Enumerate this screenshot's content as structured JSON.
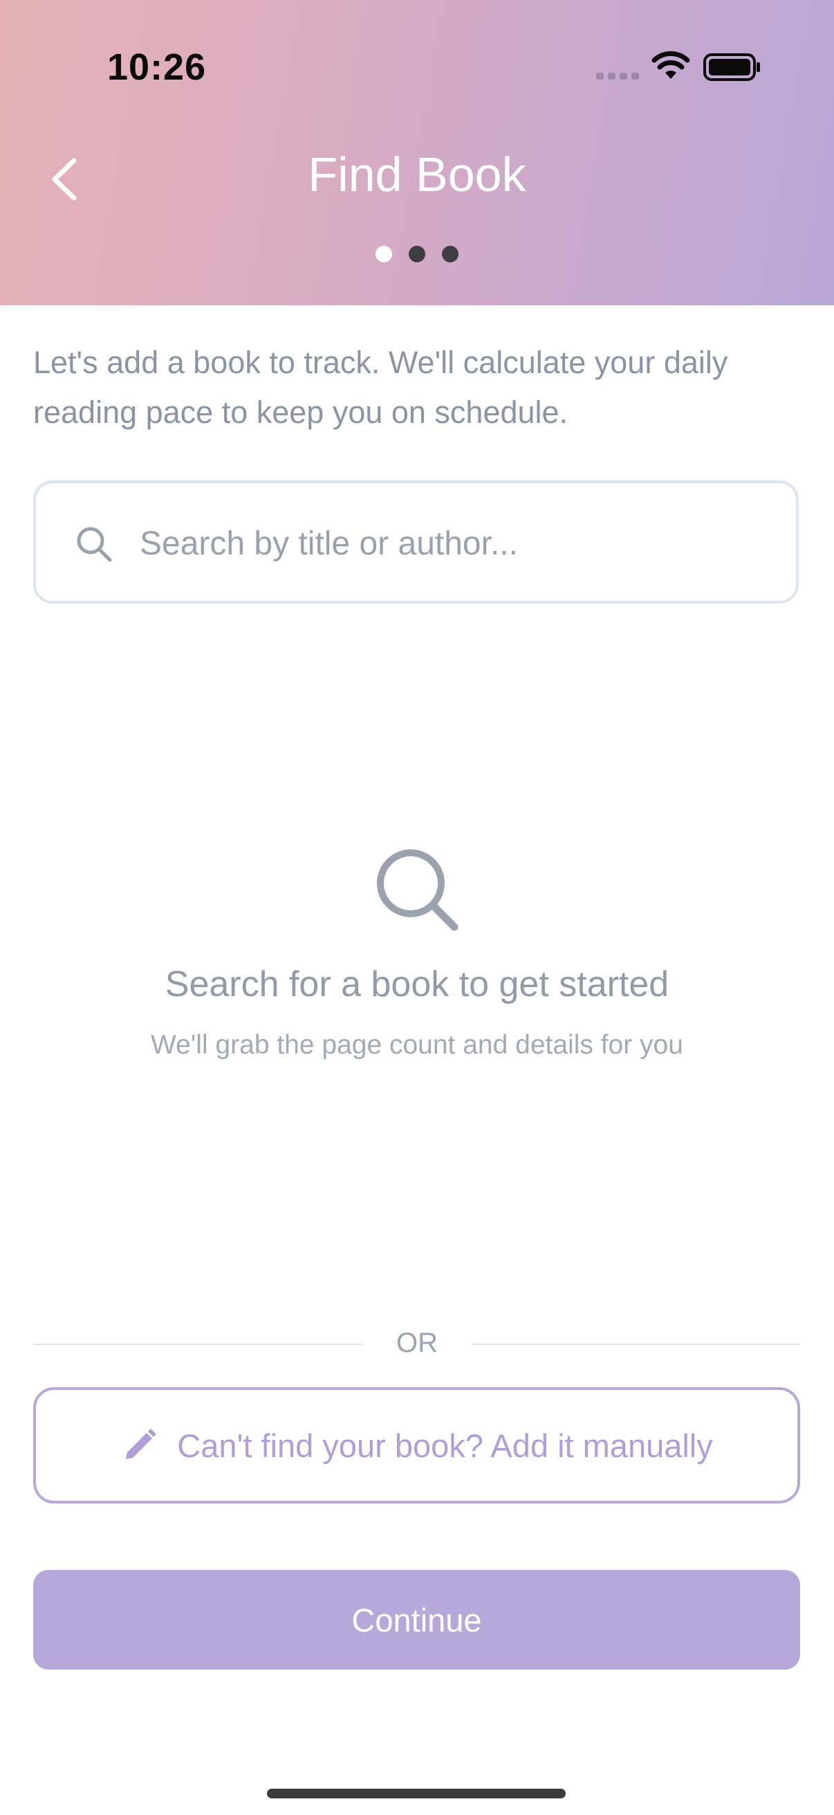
{
  "status_bar": {
    "time": "10:26",
    "signal_icon": "cellular-signal-icon",
    "wifi_icon": "wifi-icon",
    "battery_icon": "battery-icon"
  },
  "header": {
    "back_icon": "chevron-left-icon",
    "title": "Find Book",
    "steps": {
      "total": 3,
      "current": 1
    },
    "gradient_colors": [
      "#e6b2b6",
      "#b9a7d8"
    ]
  },
  "intro": {
    "text": "Let's add a book to track. We'll calculate your daily reading pace to keep you on schedule."
  },
  "search": {
    "icon": "search-icon",
    "placeholder": "Search by title or author...",
    "value": ""
  },
  "empty_state": {
    "icon": "search-icon",
    "title": "Search for a book to get started",
    "subtitle": "We'll grab the page count and details for you"
  },
  "divider": {
    "label": "OR"
  },
  "manual_add": {
    "icon": "pencil-icon",
    "label": "Can't find your book? Add it manually"
  },
  "continue_button": {
    "label": "Continue",
    "color": "#b8a7d9"
  },
  "colors": {
    "accent": "#b8a7d9",
    "muted_text": "#8c93a3"
  }
}
